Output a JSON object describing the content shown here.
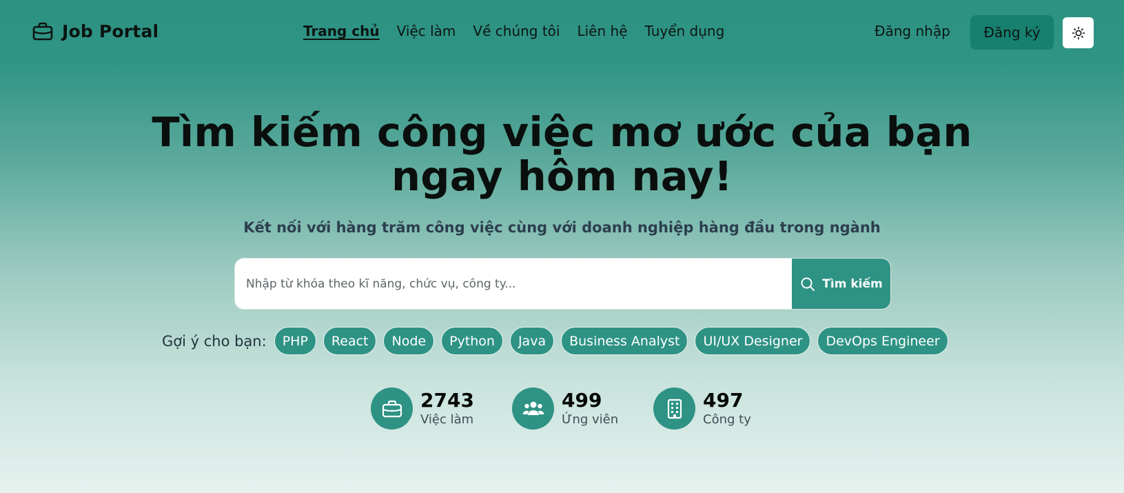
{
  "header": {
    "logo_text": "Job Portal",
    "logo_icon": "briefcase-icon",
    "nav": [
      "Trang chủ",
      "Việc làm",
      "Về chúng tôi",
      "Liên hệ",
      "Tuyển dụng"
    ],
    "active_nav": "Trang chủ",
    "login": "Đăng nhập",
    "signup": "Đăng ký",
    "theme_icon": "sun-icon"
  },
  "hero": {
    "title_line1": "Tìm kiếm công việc mơ ước của bạn",
    "title_line2": "ngay hôm nay!",
    "subtitle": "Kết nối với hàng trăm công việc cùng với doanh nghiệp hàng đầu trong ngành"
  },
  "search": {
    "placeholder": "Nhập từ khóa theo kĩ năng, chức vụ, công ty...",
    "value": "",
    "button": "Tìm kiếm"
  },
  "suggestions": {
    "label": "Gợi ý cho bạn:",
    "chips": [
      "PHP",
      "React",
      "Node",
      "Python",
      "Java",
      "Business Analyst",
      "UI/UX Designer",
      "DevOps Engineer"
    ]
  },
  "stats": [
    {
      "value": "2743",
      "label": "Việc làm",
      "icon": "briefcase-icon"
    },
    {
      "value": "499",
      "label": "Ứng viên",
      "icon": "users-icon"
    },
    {
      "value": "497",
      "label": "Công ty",
      "icon": "building-icon"
    }
  ],
  "colors": {
    "primary": "#2e9384",
    "signup_bg": "#17806f",
    "title": "#0a0f0d",
    "subtitle": "#2c3f4f"
  }
}
